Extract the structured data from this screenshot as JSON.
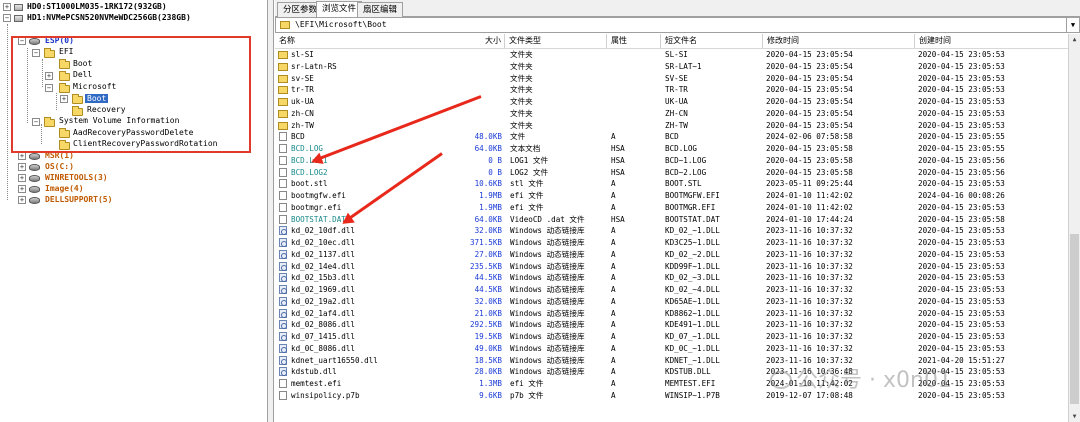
{
  "tree": {
    "disks": [
      {
        "label": "HD0:ST1000LM035-1RK172(932GB)"
      },
      {
        "label": "HD1:NVMePCSN520NVMeWDC256GB(238GB)"
      }
    ],
    "esp": "ESP(0)",
    "efi": "EFI",
    "boot": "Boot",
    "dell": "Dell",
    "microsoft": "Microsoft",
    "ms_boot": "Boot",
    "recovery": "Recovery",
    "svi": "System Volume Information",
    "aad": "AadRecoveryPasswordDelete",
    "crpr": "ClientRecoveryPasswordRotation",
    "partitions": [
      "MSR(1)",
      "OS(C:)",
      "WINRETOOLS(3)",
      "Image(4)",
      "DELLSUPPORT(5)"
    ]
  },
  "tabs": [
    "分区参数",
    "浏览文件",
    "扇区编辑"
  ],
  "active_tab": 1,
  "path": "\\EFI\\Microsoft\\Boot",
  "columns": [
    "名称",
    "大小",
    "文件类型",
    "属性",
    "短文件名",
    "修改时间",
    "创建时间"
  ],
  "rows": [
    {
      "name": "sl-SI",
      "size": "",
      "type": "文件夹",
      "attr": "",
      "short": "SL-SI",
      "mtime": "2020-04-15 23:05:54",
      "ctime": "2020-04-15 23:05:53",
      "icon": "folder"
    },
    {
      "name": "sr-Latn-RS",
      "size": "",
      "type": "文件夹",
      "attr": "",
      "short": "SR-LAT~1",
      "mtime": "2020-04-15 23:05:54",
      "ctime": "2020-04-15 23:05:53",
      "icon": "folder"
    },
    {
      "name": "sv-SE",
      "size": "",
      "type": "文件夹",
      "attr": "",
      "short": "SV-SE",
      "mtime": "2020-04-15 23:05:54",
      "ctime": "2020-04-15 23:05:53",
      "icon": "folder"
    },
    {
      "name": "tr-TR",
      "size": "",
      "type": "文件夹",
      "attr": "",
      "short": "TR-TR",
      "mtime": "2020-04-15 23:05:54",
      "ctime": "2020-04-15 23:05:53",
      "icon": "folder"
    },
    {
      "name": "uk-UA",
      "size": "",
      "type": "文件夹",
      "attr": "",
      "short": "UK-UA",
      "mtime": "2020-04-15 23:05:54",
      "ctime": "2020-04-15 23:05:53",
      "icon": "folder"
    },
    {
      "name": "zh-CN",
      "size": "",
      "type": "文件夹",
      "attr": "",
      "short": "ZH-CN",
      "mtime": "2020-04-15 23:05:54",
      "ctime": "2020-04-15 23:05:53",
      "icon": "folder"
    },
    {
      "name": "zh-TW",
      "size": "",
      "type": "文件夹",
      "attr": "",
      "short": "ZH-TW",
      "mtime": "2020-04-15 23:05:54",
      "ctime": "2020-04-15 23:05:53",
      "icon": "folder"
    },
    {
      "name": "BCD",
      "size": "48.0KB",
      "type": "文件",
      "attr": "A",
      "short": "BCD",
      "mtime": "2024-02-06 07:58:58",
      "ctime": "2020-04-15 23:05:55",
      "icon": "file"
    },
    {
      "name": "BCD.LOG",
      "size": "64.0KB",
      "type": "文本文档",
      "attr": "HSA",
      "short": "BCD.LOG",
      "mtime": "2020-04-15 23:05:58",
      "ctime": "2020-04-15 23:05:55",
      "icon": "file",
      "color": "teal"
    },
    {
      "name": "BCD.LOG1",
      "size": "0 B",
      "type": "LOG1 文件",
      "attr": "HSA",
      "short": "BCD~1.LOG",
      "mtime": "2020-04-15 23:05:58",
      "ctime": "2020-04-15 23:05:56",
      "icon": "file",
      "color": "teal"
    },
    {
      "name": "BCD.LOG2",
      "size": "0 B",
      "type": "LOG2 文件",
      "attr": "HSA",
      "short": "BCD~2.LOG",
      "mtime": "2020-04-15 23:05:58",
      "ctime": "2020-04-15 23:05:56",
      "icon": "file",
      "color": "teal"
    },
    {
      "name": "boot.stl",
      "size": "10.6KB",
      "type": "stl 文件",
      "attr": "A",
      "short": "BOOT.STL",
      "mtime": "2023-05-11 09:25:44",
      "ctime": "2020-04-15 23:05:53",
      "icon": "file"
    },
    {
      "name": "bootmgfw.efi",
      "size": "1.9MB",
      "type": "efi 文件",
      "attr": "A",
      "short": "BOOTMGFW.EFI",
      "mtime": "2024-01-10 11:42:02",
      "ctime": "2024-04-16 00:08:26",
      "icon": "file"
    },
    {
      "name": "bootmgr.efi",
      "size": "1.9MB",
      "type": "efi 文件",
      "attr": "A",
      "short": "BOOTMGR.EFI",
      "mtime": "2024-01-10 11:42:02",
      "ctime": "2020-04-15 23:05:53",
      "icon": "file"
    },
    {
      "name": "BOOTSTAT.DAT",
      "size": "64.0KB",
      "type": "VideoCD .dat 文件",
      "attr": "HSA",
      "short": "BOOTSTAT.DAT",
      "mtime": "2024-01-10 17:44:24",
      "ctime": "2020-04-15 23:05:58",
      "icon": "file",
      "color": "teal"
    },
    {
      "name": "kd_02_10df.dll",
      "size": "32.0KB",
      "type": "Windows 动态链接库",
      "attr": "A",
      "short": "KD_02_~1.DLL",
      "mtime": "2023-11-16 10:37:32",
      "ctime": "2020-04-15 23:05:53",
      "icon": "dll"
    },
    {
      "name": "kd_02_10ec.dll",
      "size": "371.5KB",
      "type": "Windows 动态链接库",
      "attr": "A",
      "short": "KD3C25~1.DLL",
      "mtime": "2023-11-16 10:37:32",
      "ctime": "2020-04-15 23:05:53",
      "icon": "dll"
    },
    {
      "name": "kd_02_1137.dll",
      "size": "27.0KB",
      "type": "Windows 动态链接库",
      "attr": "A",
      "short": "KD_02_~2.DLL",
      "mtime": "2023-11-16 10:37:32",
      "ctime": "2020-04-15 23:05:53",
      "icon": "dll"
    },
    {
      "name": "kd_02_14e4.dll",
      "size": "235.5KB",
      "type": "Windows 动态链接库",
      "attr": "A",
      "short": "KDD99F~1.DLL",
      "mtime": "2023-11-16 10:37:32",
      "ctime": "2020-04-15 23:05:53",
      "icon": "dll"
    },
    {
      "name": "kd_02_15b3.dll",
      "size": "44.5KB",
      "type": "Windows 动态链接库",
      "attr": "A",
      "short": "KD_02_~3.DLL",
      "mtime": "2023-11-16 10:37:32",
      "ctime": "2020-04-15 23:05:53",
      "icon": "dll"
    },
    {
      "name": "kd_02_1969.dll",
      "size": "44.5KB",
      "type": "Windows 动态链接库",
      "attr": "A",
      "short": "KD_02_~4.DLL",
      "mtime": "2023-11-16 10:37:32",
      "ctime": "2020-04-15 23:05:53",
      "icon": "dll"
    },
    {
      "name": "kd_02_19a2.dll",
      "size": "32.0KB",
      "type": "Windows 动态链接库",
      "attr": "A",
      "short": "KD65AE~1.DLL",
      "mtime": "2023-11-16 10:37:32",
      "ctime": "2020-04-15 23:05:53",
      "icon": "dll"
    },
    {
      "name": "kd_02_1af4.dll",
      "size": "21.0KB",
      "type": "Windows 动态链接库",
      "attr": "A",
      "short": "KD8862~1.DLL",
      "mtime": "2023-11-16 10:37:32",
      "ctime": "2020-04-15 23:05:53",
      "icon": "dll"
    },
    {
      "name": "kd_02_8086.dll",
      "size": "292.5KB",
      "type": "Windows 动态链接库",
      "attr": "A",
      "short": "KDE491~1.DLL",
      "mtime": "2023-11-16 10:37:32",
      "ctime": "2020-04-15 23:05:53",
      "icon": "dll"
    },
    {
      "name": "kd_07_1415.dll",
      "size": "19.5KB",
      "type": "Windows 动态链接库",
      "attr": "A",
      "short": "KD_07_~1.DLL",
      "mtime": "2023-11-16 10:37:32",
      "ctime": "2020-04-15 23:05:53",
      "icon": "dll"
    },
    {
      "name": "kd_0C_8086.dll",
      "size": "49.0KB",
      "type": "Windows 动态链接库",
      "attr": "A",
      "short": "KD_0C_~1.DLL",
      "mtime": "2023-11-16 10:37:32",
      "ctime": "2020-04-15 23:05:53",
      "icon": "dll"
    },
    {
      "name": "kdnet_uart16550.dll",
      "size": "18.5KB",
      "type": "Windows 动态链接库",
      "attr": "A",
      "short": "KDNET_~1.DLL",
      "mtime": "2023-11-16 10:37:32",
      "ctime": "2021-04-20 15:51:27",
      "icon": "dll"
    },
    {
      "name": "kdstub.dll",
      "size": "28.0KB",
      "type": "Windows 动态链接库",
      "attr": "A",
      "short": "KDSTUB.DLL",
      "mtime": "2023-11-16 10:36:48",
      "ctime": "2020-04-15 23:05:53",
      "icon": "dll"
    },
    {
      "name": "memtest.efi",
      "size": "1.3MB",
      "type": "efi 文件",
      "attr": "A",
      "short": "MEMTEST.EFI",
      "mtime": "2024-01-10 11:42:02",
      "ctime": "2020-04-15 23:05:53",
      "icon": "file"
    },
    {
      "name": "winsipolicy.p7b",
      "size": "9.6KB",
      "type": "p7b 文件",
      "attr": "A",
      "short": "WINSIP~1.P7B",
      "mtime": "2019-12-07 17:08:48",
      "ctime": "2020-04-15 23:05:53",
      "icon": "file"
    }
  ],
  "colors": {
    "annotation": "#e8281a",
    "selection": "#316ac5",
    "partition_orange": "#c05a00",
    "size_blue": "#1b3bd6",
    "hidden_teal": "#1a8a8a"
  },
  "watermark": "公众号 · x0n01"
}
